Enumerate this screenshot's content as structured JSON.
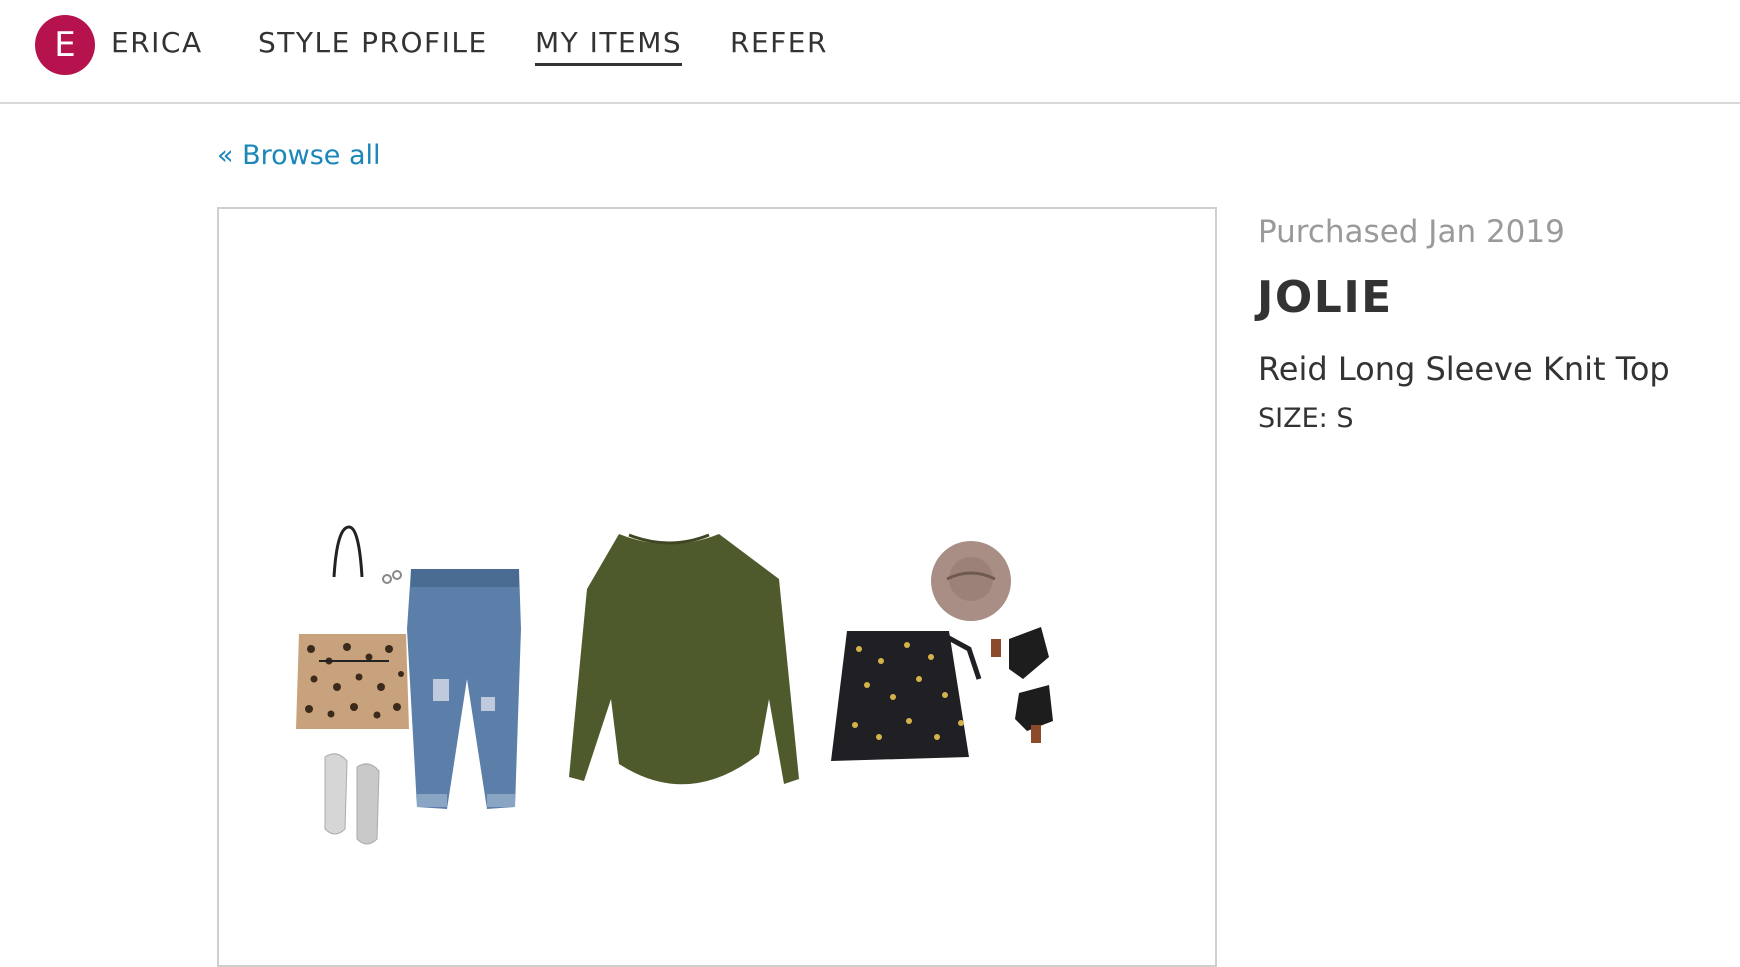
{
  "header": {
    "avatar_initial": "E",
    "user_name": "ERICA",
    "nav": {
      "style_profile": "STYLE PROFILE",
      "my_items": "MY ITEMS",
      "refer": "REFER"
    },
    "active_tab": "MY ITEMS"
  },
  "back_link": "« Browse all",
  "item": {
    "purchased": "Purchased Jan 2019",
    "brand": "JOLIE",
    "name": "Reid Long Sleeve Knit Top",
    "size": "SIZE: S"
  },
  "colors": {
    "avatar": "#b5124e",
    "link": "#1b86b8",
    "muted_text": "#9a9a9a"
  }
}
